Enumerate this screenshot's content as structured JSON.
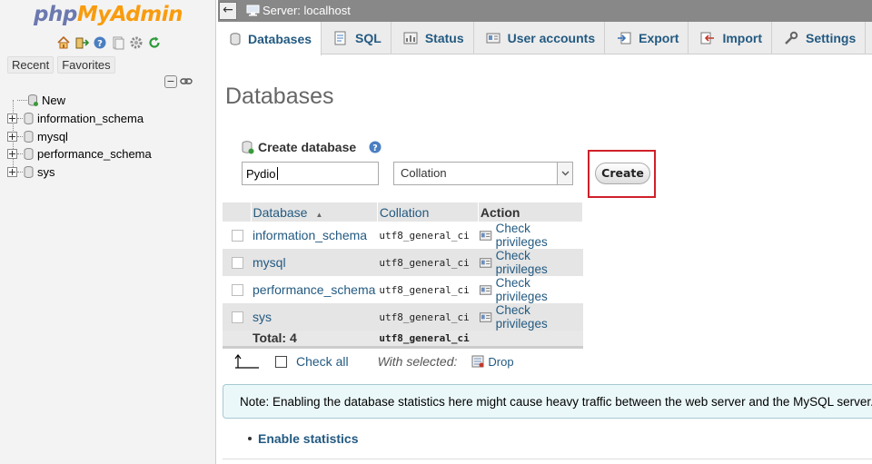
{
  "nav": {
    "logo_part1": "php",
    "logo_part2": "MyAdmin",
    "icons": [
      "home-icon",
      "logout-icon",
      "help-icon",
      "docs-icon",
      "settings-icon",
      "reload-icon"
    ],
    "recent_label": "Recent",
    "favorites_label": "Favorites",
    "tree": [
      {
        "label": "New",
        "type": "new"
      },
      {
        "label": "information_schema",
        "type": "db"
      },
      {
        "label": "mysql",
        "type": "db"
      },
      {
        "label": "performance_schema",
        "type": "db"
      },
      {
        "label": "sys",
        "type": "db"
      }
    ]
  },
  "topbar": {
    "back_label": "←",
    "server_label": "Server: localhost"
  },
  "tabs": [
    {
      "label": "Databases",
      "icon": "database-icon",
      "active": true
    },
    {
      "label": "SQL",
      "icon": "sql-icon"
    },
    {
      "label": "Status",
      "icon": "status-icon"
    },
    {
      "label": "User accounts",
      "icon": "user-accounts-icon"
    },
    {
      "label": "Export",
      "icon": "export-icon"
    },
    {
      "label": "Import",
      "icon": "import-icon"
    },
    {
      "label": "Settings",
      "icon": "wrench-icon"
    }
  ],
  "main": {
    "title": "Databases",
    "create_heading": "Create database",
    "db_name_value": "Pydio",
    "collation_value": "Collation",
    "create_button": "Create",
    "table": {
      "headers": [
        "Database",
        "Collation",
        "Action"
      ],
      "rows": [
        {
          "name": "information_schema",
          "collation": "utf8_general_ci",
          "action": "Check privileges"
        },
        {
          "name": "mysql",
          "collation": "utf8_general_ci",
          "action": "Check privileges"
        },
        {
          "name": "performance_schema",
          "collation": "utf8_general_ci",
          "action": "Check privileges"
        },
        {
          "name": "sys",
          "collation": "utf8_general_ci",
          "action": "Check privileges"
        }
      ],
      "total_label": "Total: 4",
      "total_collation": "utf8_general_ci"
    },
    "check_all": "Check all",
    "with_selected": "With selected:",
    "drop": "Drop",
    "notice": "Note: Enabling the database statistics here might cause heavy traffic between the web server and the MySQL server.",
    "enable_statistics": "Enable statistics"
  },
  "colors": {
    "link": "#235a81",
    "logo_blue": "#6c78af",
    "logo_orange": "#f89c0e",
    "highlight": "#d0202a",
    "topbar": "#888888"
  }
}
